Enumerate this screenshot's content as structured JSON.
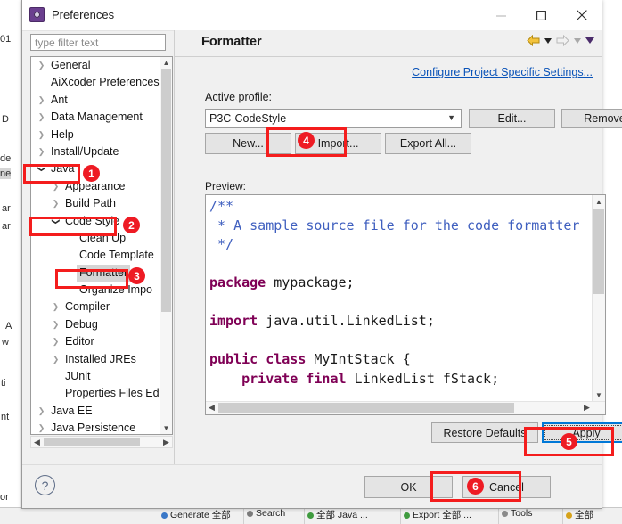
{
  "window": {
    "title": "Preferences",
    "icon": "preferences-gear-icon",
    "minimize": "minimize-icon",
    "maximize": "maximize-icon",
    "close": "close-icon"
  },
  "sidebar": {
    "filter_placeholder": "type filter text",
    "items": [
      {
        "label": "General",
        "indent": 0,
        "arrow": "collapsed"
      },
      {
        "label": "AiXcoder Preferences",
        "indent": 0,
        "arrow": "none"
      },
      {
        "label": "Ant",
        "indent": 0,
        "arrow": "collapsed"
      },
      {
        "label": "Data Management",
        "indent": 0,
        "arrow": "collapsed"
      },
      {
        "label": "Help",
        "indent": 0,
        "arrow": "collapsed"
      },
      {
        "label": "Install/Update",
        "indent": 0,
        "arrow": "collapsed"
      },
      {
        "label": "Java",
        "indent": 0,
        "arrow": "expanded"
      },
      {
        "label": "Appearance",
        "indent": 1,
        "arrow": "collapsed"
      },
      {
        "label": "Build Path",
        "indent": 1,
        "arrow": "collapsed"
      },
      {
        "label": "Code Style",
        "indent": 1,
        "arrow": "expanded"
      },
      {
        "label": "Clean Up",
        "indent": 2,
        "arrow": "none"
      },
      {
        "label": "Code Template",
        "indent": 2,
        "arrow": "none"
      },
      {
        "label": "Formatter",
        "indent": 2,
        "arrow": "none",
        "selected": true
      },
      {
        "label": "Organize Impo",
        "indent": 2,
        "arrow": "none"
      },
      {
        "label": "Compiler",
        "indent": 1,
        "arrow": "collapsed"
      },
      {
        "label": "Debug",
        "indent": 1,
        "arrow": "collapsed"
      },
      {
        "label": "Editor",
        "indent": 1,
        "arrow": "collapsed"
      },
      {
        "label": "Installed JREs",
        "indent": 1,
        "arrow": "collapsed"
      },
      {
        "label": "JUnit",
        "indent": 1,
        "arrow": "none"
      },
      {
        "label": "Properties Files Ed",
        "indent": 1,
        "arrow": "none"
      },
      {
        "label": "Java EE",
        "indent": 0,
        "arrow": "collapsed"
      },
      {
        "label": "Java Persistence",
        "indent": 0,
        "arrow": "collapsed"
      }
    ]
  },
  "main": {
    "page_title": "Formatter",
    "nav": {
      "back": "back-arrow-icon",
      "back_menu": "back-dropdown-icon",
      "forward": "forward-arrow-icon",
      "forward_menu": "forward-dropdown-icon",
      "view_menu": "view-menu-icon"
    },
    "project_link": "Configure Project Specific Settings...",
    "active_profile_label": "Active profile:",
    "active_profile_value": "P3C-CodeStyle",
    "buttons": {
      "edit": "Edit...",
      "remove": "Remove",
      "new": "New...",
      "import": "Import...",
      "export_all": "Export All..."
    },
    "preview_label": "Preview:",
    "preview_code": [
      {
        "t": "/**",
        "k": "cmt"
      },
      {
        "t": " * A sample source file for the code formatter",
        "k": "cmt"
      },
      {
        "t": " */",
        "k": "cmt"
      },
      {
        "t": "",
        "k": "plain"
      },
      {
        "t": "package mypackage;",
        "k": "mix",
        "kw": [
          "package"
        ]
      },
      {
        "t": "",
        "k": "plain"
      },
      {
        "t": "import java.util.LinkedList;",
        "k": "mix",
        "kw": [
          "import"
        ]
      },
      {
        "t": "",
        "k": "plain"
      },
      {
        "t": "public class MyIntStack {",
        "k": "mix",
        "kw": [
          "public",
          "class"
        ]
      },
      {
        "t": "    private final LinkedList fStack;",
        "k": "mix",
        "kw": [
          "private",
          "final"
        ]
      }
    ],
    "restore_defaults": "Restore Defaults",
    "apply": "Apply"
  },
  "footer": {
    "help": "help-icon",
    "ok": "OK",
    "cancel": "Cancel"
  },
  "annotations": [
    {
      "n": "1",
      "target": "sidebar-item-java"
    },
    {
      "n": "2",
      "target": "sidebar-item-code-style"
    },
    {
      "n": "3",
      "target": "sidebar-item-formatter"
    },
    {
      "n": "4",
      "target": "import-button"
    },
    {
      "n": "5",
      "target": "apply-button"
    },
    {
      "n": "6",
      "target": "ok-button"
    }
  ],
  "colors": {
    "annotation": "#ee1b24",
    "link": "#0a53b8",
    "keyword": "#7f0055",
    "comment": "#3f5fbf",
    "selection": "#d5d5d5",
    "focus": "#0078d7"
  },
  "background": {
    "fragments": [
      "01",
      "D",
      "de",
      "ne",
      "ar",
      "ar",
      "A",
      "w",
      "ti",
      "nt",
      "or"
    ],
    "toolbar_items": [
      {
        "label": "Generate 全部",
        "icon": "blue-window-icon"
      },
      {
        "label": "Search",
        "icon": "magnifier-icon"
      },
      {
        "label": "全部 Java ...",
        "icon": "green-tree-icon"
      },
      {
        "label": "Export 全部 ...",
        "icon": "person-icon"
      },
      {
        "label": "Tools",
        "icon": "printer-icon"
      },
      {
        "label": "全部",
        "icon": "package-icon"
      }
    ]
  }
}
